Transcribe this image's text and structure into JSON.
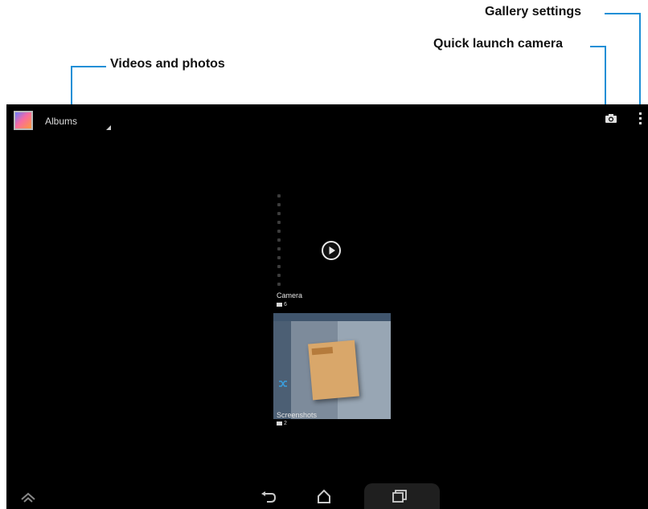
{
  "callouts": {
    "gallery_settings": "Gallery settings",
    "quick_launch_camera": "Quick launch camera",
    "videos_and_photos": "Videos and photos"
  },
  "colors": {
    "callout_line": "#1e8fd6",
    "screen_bg": "#000000"
  },
  "action_bar": {
    "app_icon": "gallery-icon",
    "album_selector": "Albums",
    "camera_icon": "camera-icon",
    "overflow_icon": "overflow-menu-icon"
  },
  "albums": [
    {
      "name": "Camera",
      "count": "6",
      "icon": "camera-folder-icon"
    },
    {
      "name": "Screenshots",
      "count": "2",
      "icon": "folder-icon"
    }
  ],
  "navbar": {
    "items": [
      "up-arrow-icon",
      "back-icon",
      "home-icon",
      "recent-apps-icon"
    ]
  }
}
